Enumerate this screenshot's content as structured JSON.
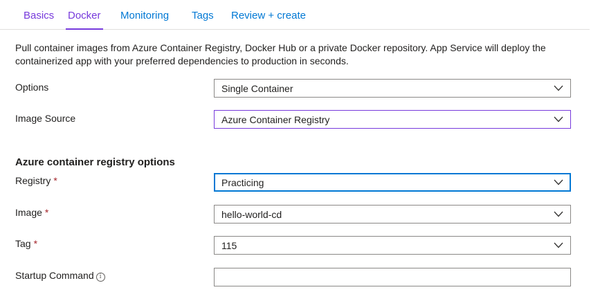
{
  "tabs": [
    {
      "label": "Basics"
    },
    {
      "label": "Docker"
    },
    {
      "label": "Monitoring"
    },
    {
      "label": "Tags"
    },
    {
      "label": "Review + create"
    }
  ],
  "active_tab": "Docker",
  "description": "Pull container images from Azure Container Registry, Docker Hub or a private Docker repository. App Service will deploy the containerized app with your preferred dependencies to production in seconds.",
  "fields": {
    "options": {
      "label": "Options",
      "value": "Single Container"
    },
    "image_source": {
      "label": "Image Source",
      "value": "Azure Container Registry"
    }
  },
  "section_title": "Azure container registry options",
  "registry_fields": {
    "registry": {
      "label": "Registry",
      "required_mark": "*",
      "value": "Practicing"
    },
    "image": {
      "label": "Image",
      "required_mark": "*",
      "value": "hello-world-cd"
    },
    "tag": {
      "label": "Tag",
      "required_mark": "*",
      "value": "115"
    },
    "startup_command": {
      "label": "Startup Command",
      "info": "i",
      "value": ""
    }
  },
  "icons": {
    "dropdown": "chevron-down-icon",
    "info": "info-icon"
  },
  "colors": {
    "link_blue": "#0078d4",
    "visited_purple": "#773adc",
    "required_red": "#a4262c",
    "focus_blue": "#0078d4"
  }
}
